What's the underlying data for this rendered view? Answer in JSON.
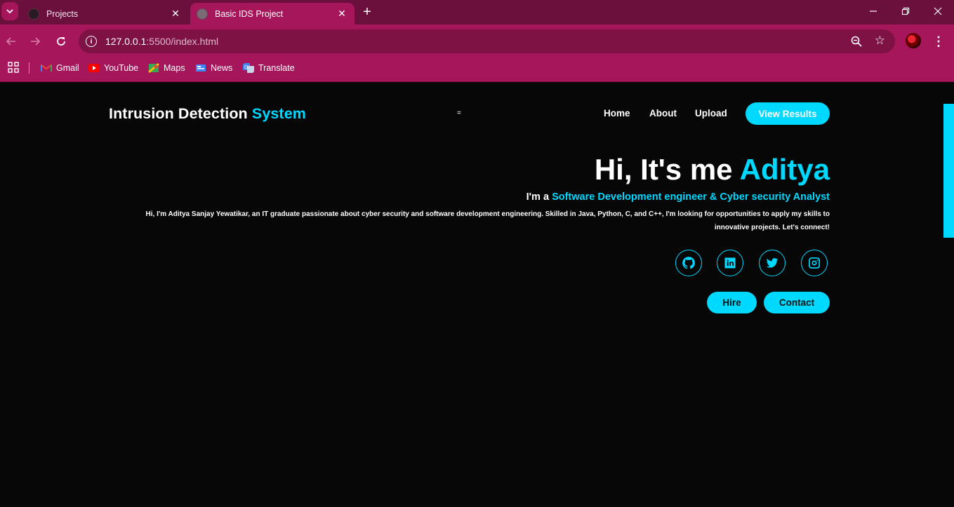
{
  "browser": {
    "tabs": [
      {
        "title": "Projects",
        "active": false
      },
      {
        "title": "Basic IDS Project",
        "active": true
      }
    ],
    "url_host": "127.0.0.1",
    "url_path": ":5500/index.html",
    "bookmarks": [
      "Gmail",
      "YouTube",
      "Maps",
      "News",
      "Translate"
    ],
    "colors": {
      "frame": "#6b0f3c",
      "toolbar": "#a6165a",
      "omnibox": "#7f1244"
    }
  },
  "site": {
    "logo_main": "Intrusion Detection ",
    "logo_accent": "System",
    "menu_toggle": "=",
    "nav": [
      "Home",
      "About",
      "Upload"
    ],
    "cta": "View Results",
    "hero": {
      "greeting": "Hi, It's me ",
      "name": "Aditya",
      "role_prefix": "I'm a ",
      "role": "Software Development engineer & Cyber security Analyst",
      "description": "Hi, I'm Aditya Sanjay Yewatikar, an IT graduate passionate about cyber security and software development engineering. Skilled in Java, Python, C, and C++, I'm looking for opportunities to apply my skills to innovative projects. Let's connect!"
    },
    "social_icons": [
      "github-icon",
      "linkedin-icon",
      "twitter-icon",
      "instagram-icon"
    ],
    "buttons": {
      "hire": "Hire",
      "contact": "Contact"
    },
    "colors": {
      "accent": "#00d9ff",
      "background": "#070707",
      "text": "#ffffff"
    }
  }
}
